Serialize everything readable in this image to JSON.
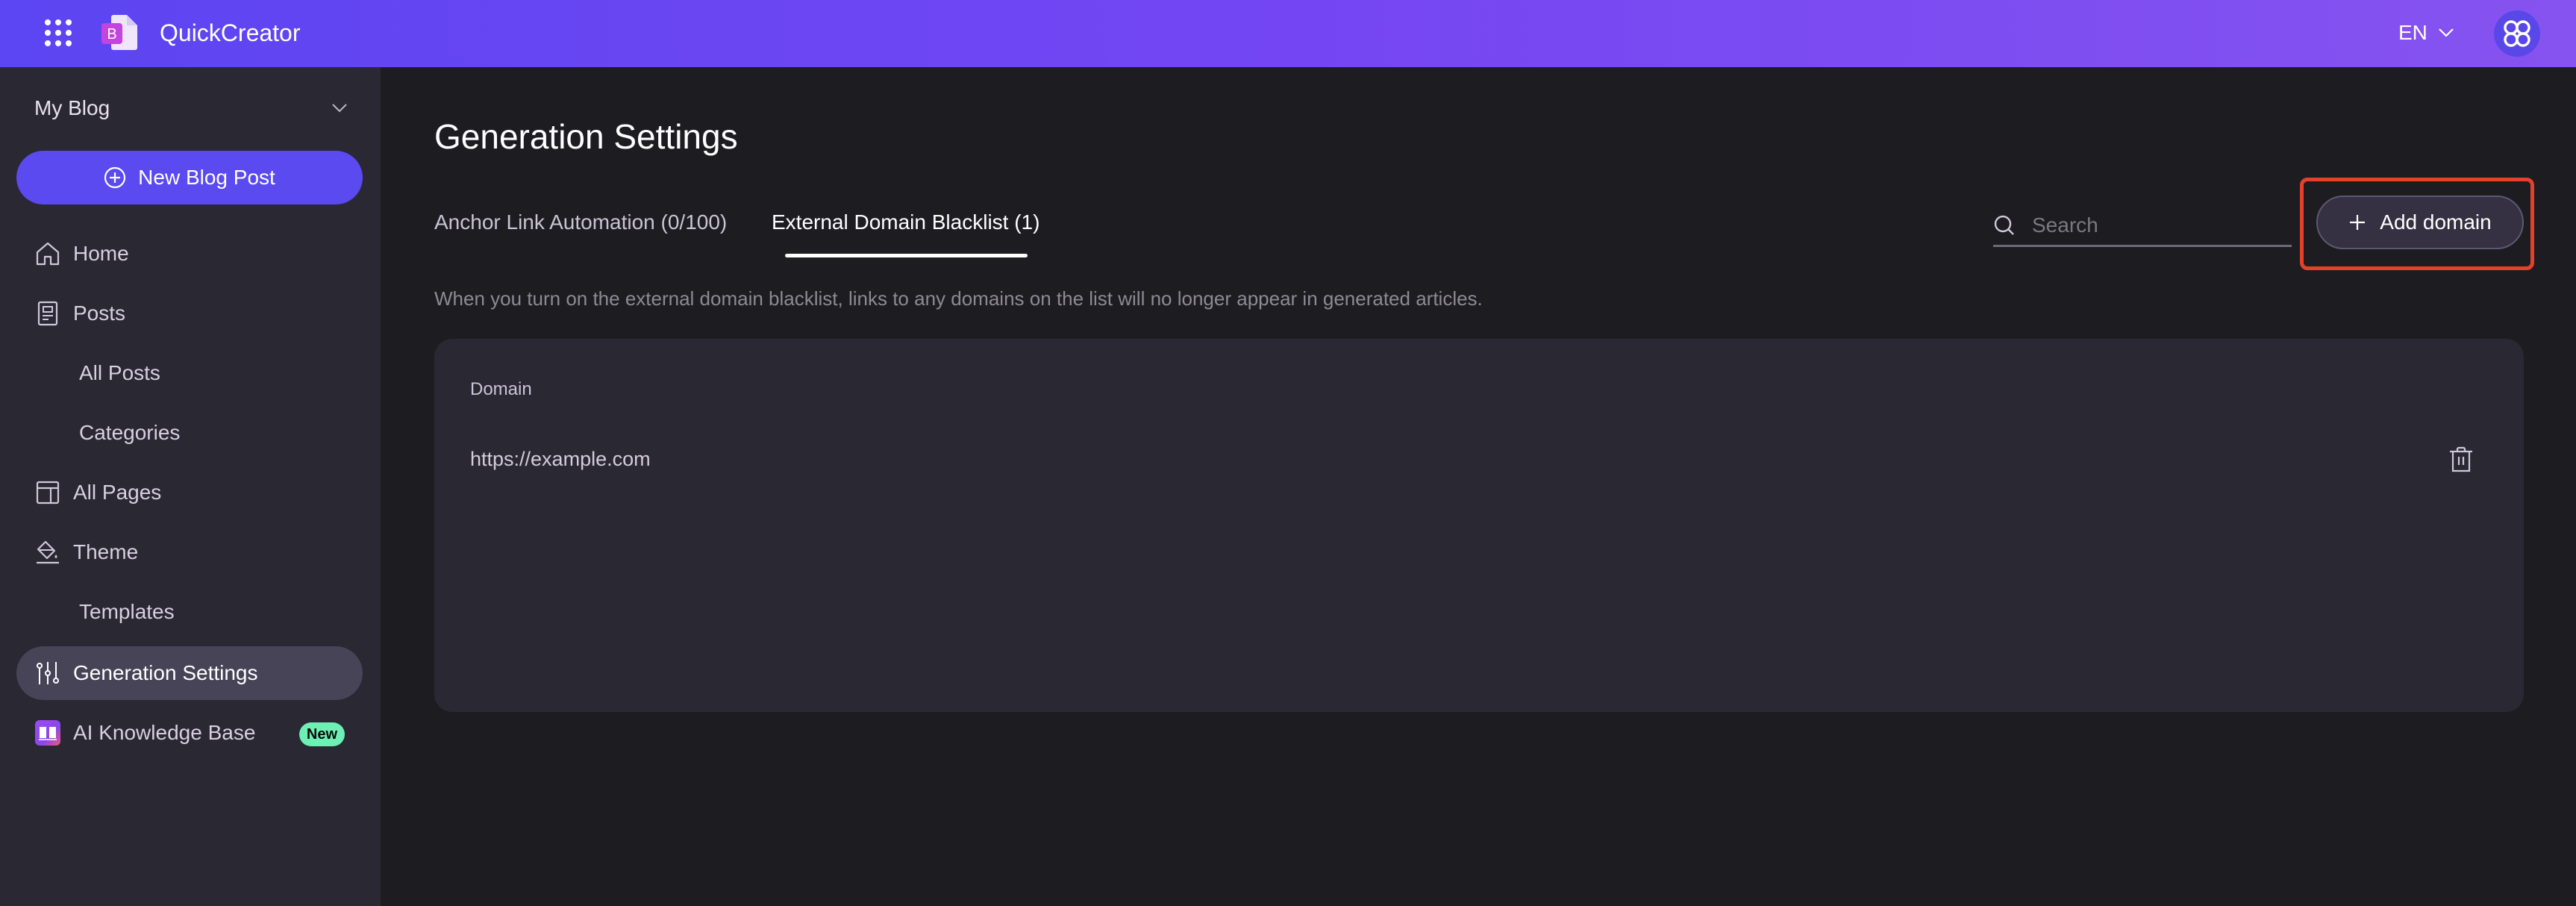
{
  "header": {
    "app_title": "QuickCreator",
    "language": "EN",
    "brand_color": "#5c45f2",
    "icons": {
      "apps": "apps-grid-icon",
      "logo": "quickcreator-logo-icon",
      "lang_chevron": "chevron-down-icon",
      "avatar": "clover-avatar-icon"
    }
  },
  "sidebar": {
    "blog_selector": "My Blog",
    "new_post_label": "New Blog Post",
    "items": [
      {
        "label": "Home",
        "icon": "home-icon"
      },
      {
        "label": "Posts",
        "icon": "posts-icon"
      },
      {
        "label": "All Posts",
        "sub": true
      },
      {
        "label": "Categories",
        "sub": true
      },
      {
        "label": "All Pages",
        "icon": "pages-icon"
      },
      {
        "label": "Theme",
        "icon": "paint-bucket-icon"
      },
      {
        "label": "Templates",
        "sub": true
      },
      {
        "label": "Generation Settings",
        "icon": "sliders-icon",
        "active": true
      },
      {
        "label": "AI Knowledge Base",
        "icon": "book-icon",
        "badge": "New"
      }
    ]
  },
  "main": {
    "title": "Generation Settings",
    "tabs": [
      {
        "label": "Anchor Link Automation (0/100)",
        "active": false
      },
      {
        "label": "External Domain Blacklist (1)",
        "active": true
      }
    ],
    "search": {
      "placeholder": "Search",
      "value": ""
    },
    "add_domain_label": "Add domain",
    "description": "When you turn on the external domain blacklist, links to any domains on the list will no longer appear in generated articles.",
    "table": {
      "columns": [
        "Domain"
      ],
      "rows": [
        {
          "domain": "https://example.com"
        }
      ]
    },
    "highlight_color": "#e4412b"
  }
}
